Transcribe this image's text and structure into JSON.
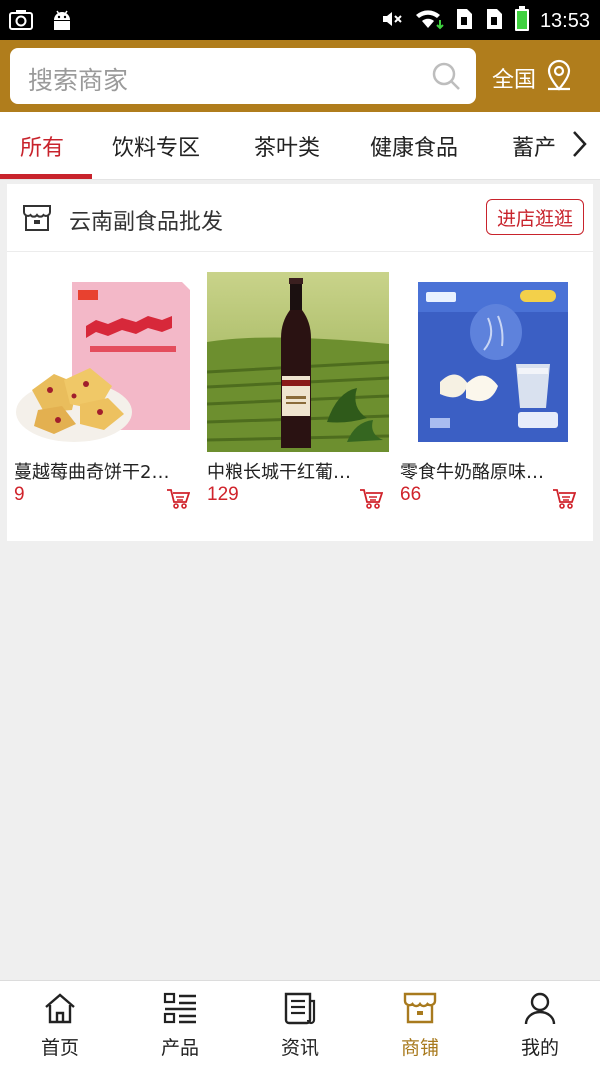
{
  "status_bar": {
    "time": "13:53"
  },
  "search": {
    "placeholder": "搜索商家"
  },
  "region": {
    "label": "全国"
  },
  "tabs": [
    {
      "label": "所有",
      "active": true
    },
    {
      "label": "饮料专区"
    },
    {
      "label": "茶叶类"
    },
    {
      "label": "健康食品"
    },
    {
      "label": "蓄产"
    }
  ],
  "store": {
    "name": "云南副食品批发",
    "enter_label": "进店逛逛",
    "products": [
      {
        "name": "蔓越莓曲奇饼干2…",
        "price": "9",
        "image": "cranberry-cookies-pack"
      },
      {
        "name": "中粮长城干红葡…",
        "price": "129",
        "image": "red-wine-bottle-vineyard"
      },
      {
        "name": "零食牛奶酪原味…",
        "price": "66",
        "image": "milk-cheese-snack-pack"
      }
    ]
  },
  "bottom_nav": [
    {
      "label": "首页",
      "icon": "home-icon"
    },
    {
      "label": "产品",
      "icon": "list-icon"
    },
    {
      "label": "资讯",
      "icon": "news-icon"
    },
    {
      "label": "商铺",
      "icon": "shop-icon",
      "active": true
    },
    {
      "label": "我的",
      "icon": "user-icon"
    }
  ],
  "colors": {
    "brand": "#b07d1c",
    "accent_red": "#c8232c",
    "active_nav": "#a87a1e"
  }
}
